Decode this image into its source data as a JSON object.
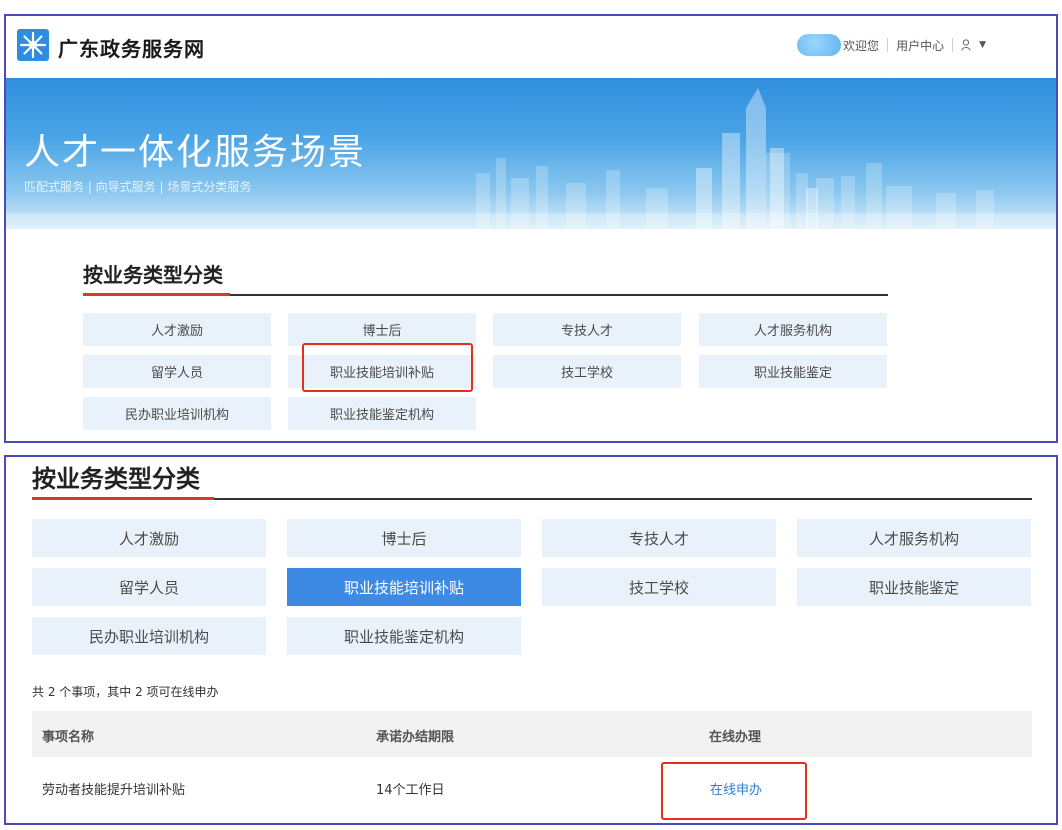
{
  "header": {
    "site_name": "广东政务服务网",
    "welcome": "欢迎您",
    "user_center": "用户中心"
  },
  "banner": {
    "title": "人才一体化服务场景",
    "subtitle": "匹配式服务 | 向导式服务 | 场景式分类服务"
  },
  "section_title": "按业务类型分类",
  "categories": [
    "人才激励",
    "博士后",
    "专技人才",
    "人才服务机构",
    "留学人员",
    "职业技能培训补贴",
    "技工学校",
    "职业技能鉴定",
    "民办职业培训机构",
    "职业技能鉴定机构"
  ],
  "selected_category": "职业技能培训补贴",
  "result": {
    "summary": "共 2 个事项，其中 2 项可在线申办",
    "columns": [
      "事项名称",
      "承诺办结期限",
      "在线办理"
    ],
    "rows": [
      {
        "name": "劳动者技能提升培训补贴",
        "deadline": "14个工作日",
        "action": "在线申办"
      }
    ]
  },
  "colors": {
    "frame": "#4a4ab8",
    "accent_red": "#d23a2a",
    "active_blue": "#3d8ae5",
    "button_bg": "#e9f2fb",
    "link": "#2a7fd9"
  },
  "icons": [
    "logo-icon",
    "user-icon",
    "caret-down-icon"
  ]
}
